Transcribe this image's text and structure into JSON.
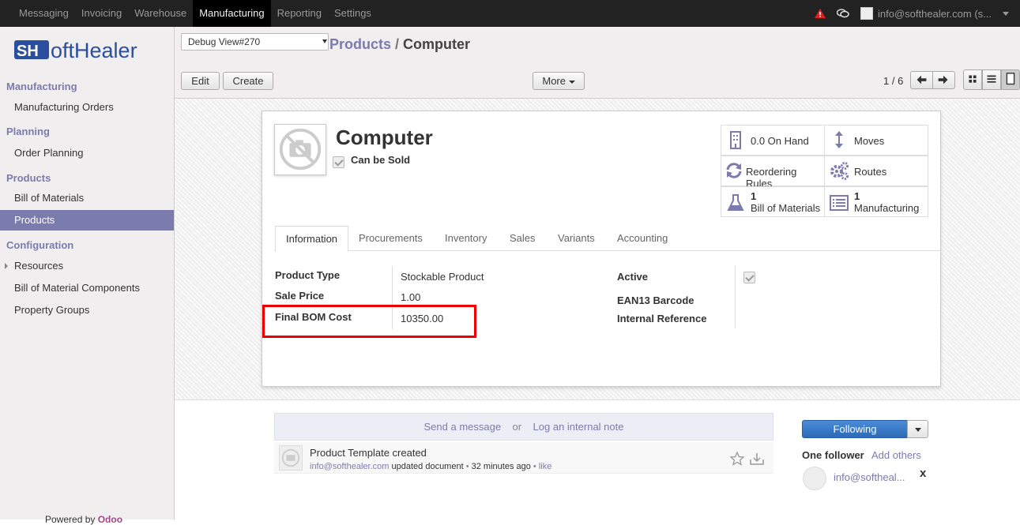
{
  "topbar": {
    "menu": [
      "Messaging",
      "Invoicing",
      "Warehouse",
      "Manufacturing",
      "Reporting",
      "Settings"
    ],
    "active": "Manufacturing",
    "user": "info@softhealer.com (s..."
  },
  "sidebar": {
    "logo_text": "SofHealer",
    "sections": [
      {
        "title": "Manufacturing",
        "items": [
          "Manufacturing Orders"
        ]
      },
      {
        "title": "Planning",
        "items": [
          "Order Planning"
        ]
      },
      {
        "title": "Products",
        "items": [
          "Bill of Materials",
          "Products"
        ]
      },
      {
        "title": "Configuration",
        "items": [
          "Resources",
          "Bill of Material Components",
          "Property Groups"
        ]
      }
    ],
    "selected": "Products",
    "powered_prefix": "Powered by",
    "powered_brand": "Odoo"
  },
  "control": {
    "debug_select": "Debug View#270",
    "breadcrumb_parent": "Products",
    "breadcrumb_sep": " / ",
    "breadcrumb_current": "Computer",
    "edit": "Edit",
    "create": "Create",
    "more": "More",
    "pager": "1 / 6"
  },
  "product": {
    "name": "Computer",
    "can_be_sold_label": "Can be Sold",
    "smart_buttons": {
      "on_hand": "0.0 On Hand",
      "moves": "Moves",
      "reordering": "Reordering Rules",
      "routes": "Routes",
      "bom_count": "1",
      "bom_label": "Bill of Materials",
      "mfg_count": "1",
      "mfg_label": "Manufacturing"
    },
    "tabs": [
      "Information",
      "Procurements",
      "Inventory",
      "Sales",
      "Variants",
      "Accounting"
    ],
    "active_tab": "Information",
    "fields_left": [
      {
        "label": "Product Type",
        "value": "Stockable Product"
      },
      {
        "label": "Sale Price",
        "value": "1.00"
      },
      {
        "label": "Final BOM Cost",
        "value": "10350.00"
      }
    ],
    "fields_right": [
      "Active",
      "EAN13 Barcode",
      "Internal Reference"
    ]
  },
  "chatter": {
    "send": "Send a message",
    "or": "or",
    "log": "Log an internal note",
    "message_title": "Product Template created",
    "message_author": "info@softhealer.com",
    "message_action": "updated document",
    "message_time": "32 minutes ago",
    "message_like": "like",
    "following": "Following",
    "followers_count": "One follower",
    "add_others": "Add others",
    "follower_name": "info@softheal...",
    "remove": "x"
  },
  "colors": {
    "accent": "#7c7bad",
    "highlight": "#e00000",
    "topbar": "#222222"
  }
}
